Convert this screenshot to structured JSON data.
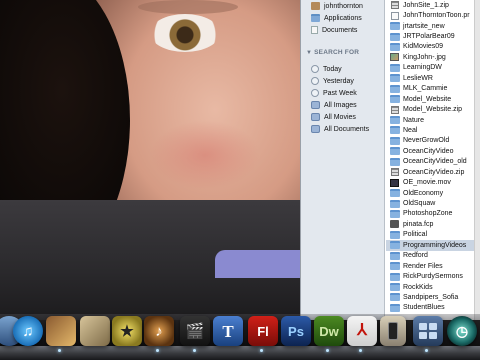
{
  "sidebar": {
    "places": [
      {
        "label": "johnthornton",
        "icon": "home-folder-icon"
      },
      {
        "label": "Applications",
        "icon": "applications-folder-icon"
      },
      {
        "label": "Documents",
        "icon": "documents-folder-icon"
      }
    ],
    "search_for_heading": "SEARCH FOR",
    "searches": [
      {
        "label": "Today",
        "icon": "clock-icon"
      },
      {
        "label": "Yesterday",
        "icon": "clock-icon"
      },
      {
        "label": "Past Week",
        "icon": "clock-icon"
      },
      {
        "label": "All Images",
        "icon": "smart-folder-icon"
      },
      {
        "label": "All Movies",
        "icon": "smart-folder-icon"
      },
      {
        "label": "All Documents",
        "icon": "smart-folder-icon"
      }
    ]
  },
  "file_list": [
    {
      "name": "JohnSite_1.zip",
      "kind": "zip"
    },
    {
      "name": "JohnThorntonToon.pr",
      "kind": "file"
    },
    {
      "name": "jrtartsite_new",
      "kind": "folder"
    },
    {
      "name": "JRTPolarBear09",
      "kind": "folder"
    },
    {
      "name": "KidMovies09",
      "kind": "folder"
    },
    {
      "name": "KingJohn-.jpg",
      "kind": "image"
    },
    {
      "name": "LearningDW",
      "kind": "folder"
    },
    {
      "name": "LeslieWR",
      "kind": "folder"
    },
    {
      "name": "MLK_Cammie",
      "kind": "folder"
    },
    {
      "name": "Model_Website",
      "kind": "folder"
    },
    {
      "name": "Model_Website.zip",
      "kind": "zip"
    },
    {
      "name": "Nature",
      "kind": "folder"
    },
    {
      "name": "Neal",
      "kind": "folder"
    },
    {
      "name": "NeverGrowOld",
      "kind": "folder"
    },
    {
      "name": "OceanCityVideo",
      "kind": "folder"
    },
    {
      "name": "OceanCityVideo_old",
      "kind": "folder"
    },
    {
      "name": "OceanCityVideo.zip",
      "kind": "zip"
    },
    {
      "name": "OE_movie.mov",
      "kind": "movie"
    },
    {
      "name": "OldEconomy",
      "kind": "folder"
    },
    {
      "name": "OldSquaw",
      "kind": "folder"
    },
    {
      "name": "PhotoshopZone",
      "kind": "folder"
    },
    {
      "name": "pinata.fcp",
      "kind": "fcp"
    },
    {
      "name": "Political",
      "kind": "folder"
    },
    {
      "name": "ProgrammingVideos",
      "kind": "folder",
      "selected": true
    },
    {
      "name": "Redford",
      "kind": "folder"
    },
    {
      "name": "Render Files",
      "kind": "folder"
    },
    {
      "name": "RickPurdySermons",
      "kind": "folder"
    },
    {
      "name": "RockKids",
      "kind": "folder"
    },
    {
      "name": "Sandpipers_Sofia",
      "kind": "folder"
    },
    {
      "name": "StudentBlues",
      "kind": "folder"
    }
  ],
  "dock": [
    {
      "name": "mail-icon",
      "glyph": ""
    },
    {
      "name": "itunes-icon",
      "glyph": "♫"
    },
    {
      "name": "image-capture-icon",
      "glyph": ""
    },
    {
      "name": "iphoto-icon",
      "glyph": ""
    },
    {
      "name": "imovie-icon",
      "glyph": "★"
    },
    {
      "name": "garageband-icon",
      "glyph": "♪"
    },
    {
      "name": "final-cut-icon",
      "glyph": "🎬"
    },
    {
      "name": "keynote-icon",
      "glyph": "T"
    },
    {
      "name": "flash-icon",
      "glyph": "Fl"
    },
    {
      "name": "photoshop-icon",
      "glyph": "Ps"
    },
    {
      "name": "dreamweaver-icon",
      "glyph": "Dw"
    },
    {
      "name": "acrobat-icon",
      "glyph": "⅄"
    },
    {
      "name": "iphone-config-icon",
      "glyph": ""
    },
    {
      "name": "spaces-icon",
      "glyph": ""
    },
    {
      "name": "time-machine-icon",
      "glyph": "◷"
    }
  ]
}
